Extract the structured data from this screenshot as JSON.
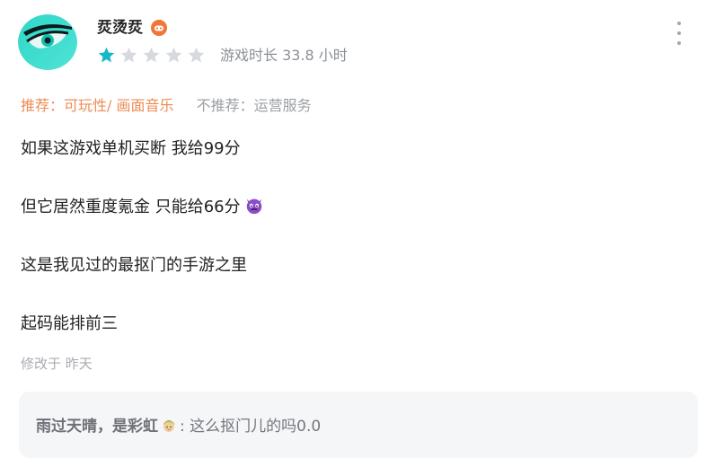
{
  "review": {
    "author": {
      "name": "烎烫烎",
      "badge_icon": "gamepad-badge-icon",
      "avatar_icon": "teal-eye-avatar"
    },
    "rating": {
      "value": 1,
      "max": 5,
      "filled_color": "#14b9c8",
      "empty_color": "#d6d9dd"
    },
    "playtime": "游戏时长 33.8 小时",
    "more_icon": "more-vertical-icon",
    "tags": {
      "recommend": "推荐：可玩性/ 画面音乐",
      "not_recommend": "不推荐：运营服务",
      "recommend_color": "#ee8c55"
    },
    "body": {
      "line1": "如果这游戏单机买断 我给99分",
      "line2": "但它居然重度氪金 只能给66分",
      "line2_emoji": "purple-devil-emoji",
      "line3": "这是我见过的最抠门的手游之里",
      "line4": "起码能排前三"
    },
    "edited": "修改于 昨天"
  },
  "reply": {
    "author": "雨过天晴，是彩虹",
    "author_badge": "link-character-badge-icon",
    "text": ": 这么抠门儿的吗0.0"
  }
}
